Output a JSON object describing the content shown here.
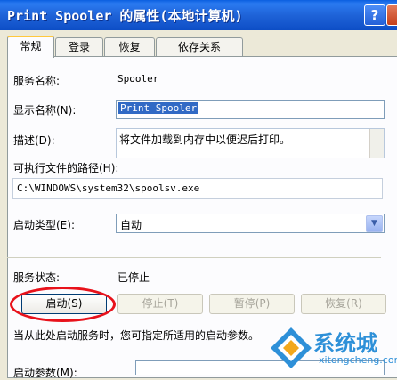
{
  "window": {
    "title": "Print Spooler 的属性(本地计算机)",
    "help_label": "?"
  },
  "tabs": [
    {
      "label": "常规"
    },
    {
      "label": "登录"
    },
    {
      "label": "恢复"
    },
    {
      "label": "依存关系"
    }
  ],
  "general": {
    "service_name_label": "服务名称:",
    "service_name_value": "Spooler",
    "display_name_label": "显示名称(N):",
    "display_name_value": "Print Spooler",
    "description_label": "描述(D):",
    "description_value": "将文件加载到内存中以便迟后打印。",
    "exe_path_label": "可执行文件的路径(H):",
    "exe_path_value": "C:\\WINDOWS\\system32\\spoolsv.exe",
    "startup_type_label": "启动类型(E):",
    "startup_type_value": "自动",
    "status_label": "服务状态:",
    "status_value": "已停止",
    "note": "当从此处启动服务时，您可指定所适用的启动参数。",
    "start_params_label": "启动参数(M):"
  },
  "buttons": {
    "start": "启动(S)",
    "stop": "停止(T)",
    "pause": "暂停(P)",
    "resume": "恢复(R)"
  },
  "watermark": {
    "brand": "系统城",
    "domain": "xitongcheng.com"
  }
}
